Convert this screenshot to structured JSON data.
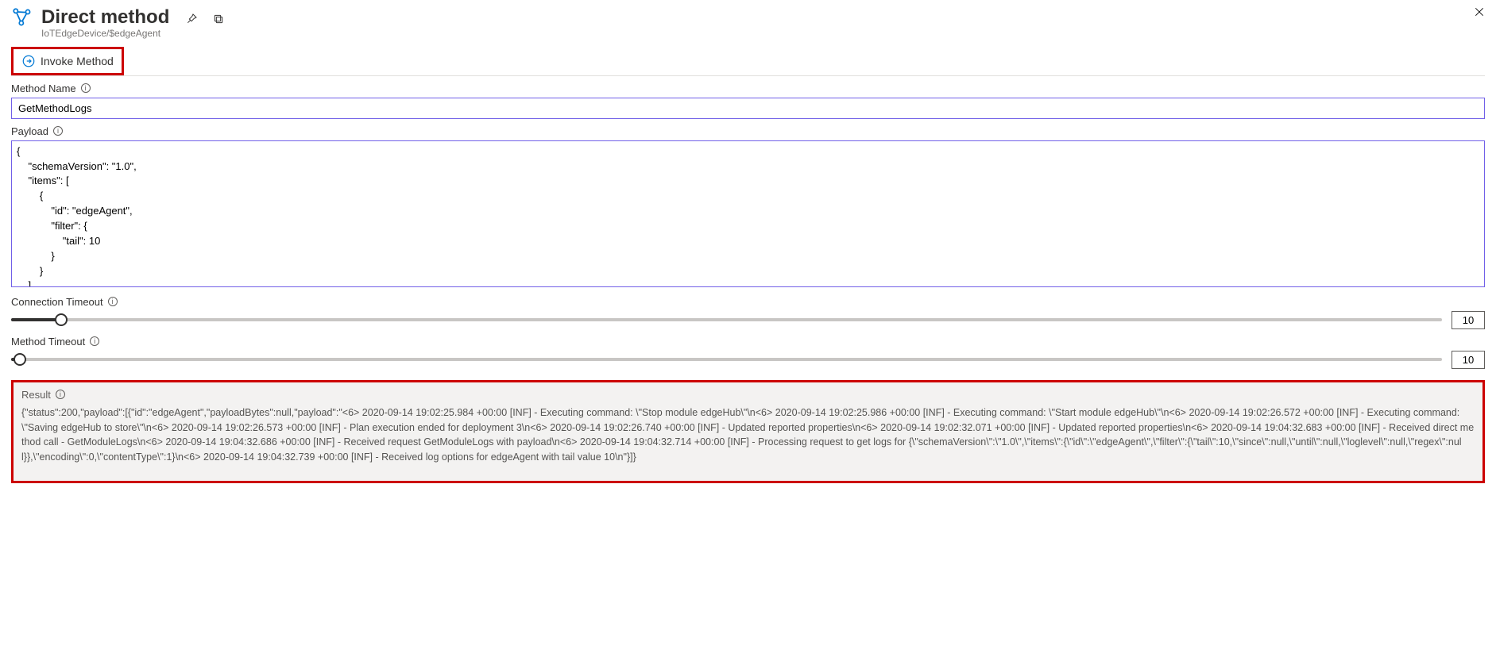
{
  "header": {
    "title": "Direct method",
    "breadcrumb": "IoTEdgeDevice/$edgeAgent"
  },
  "toolbar": {
    "invoke_label": "Invoke Method"
  },
  "method_name": {
    "label": "Method Name",
    "value": "GetMethodLogs"
  },
  "payload": {
    "label": "Payload",
    "value": "{\n    \"schemaVersion\": \"1.0\",\n    \"items\": [\n        {\n            \"id\": \"edgeAgent\",\n            \"filter\": {\n                \"tail\": 10\n            }\n        }\n    ],"
  },
  "connection_timeout": {
    "label": "Connection Timeout",
    "value": "10",
    "fill_pct": 3.5
  },
  "method_timeout": {
    "label": "Method Timeout",
    "value": "10",
    "fill_pct": 0.6
  },
  "result": {
    "label": "Result",
    "text": "{\"status\":200,\"payload\":[{\"id\":\"edgeAgent\",\"payloadBytes\":null,\"payload\":\"<6> 2020-09-14 19:02:25.984 +00:00 [INF] - Executing command: \\\"Stop module edgeHub\\\"\\n<6> 2020-09-14 19:02:25.986 +00:00 [INF] - Executing command: \\\"Start module edgeHub\\\"\\n<6> 2020-09-14 19:02:26.572 +00:00 [INF] - Executing command: \\\"Saving edgeHub to store\\\"\\n<6> 2020-09-14 19:02:26.573 +00:00 [INF] - Plan execution ended for deployment 3\\n<6> 2020-09-14 19:02:26.740 +00:00 [INF] - Updated reported properties\\n<6> 2020-09-14 19:02:32.071 +00:00 [INF] - Updated reported properties\\n<6> 2020-09-14 19:04:32.683 +00:00 [INF] - Received direct method call - GetModuleLogs\\n<6> 2020-09-14 19:04:32.686 +00:00 [INF] - Received request GetModuleLogs with payload\\n<6> 2020-09-14 19:04:32.714 +00:00 [INF] - Processing request to get logs for {\\\"schemaVersion\\\":\\\"1.0\\\",\\\"items\\\":{\\\"id\\\":\\\"edgeAgent\\\",\\\"filter\\\":{\\\"tail\\\":10,\\\"since\\\":null,\\\"until\\\":null,\\\"loglevel\\\":null,\\\"regex\\\":null}},\\\"encoding\\\":0,\\\"contentType\\\":1}\\n<6> 2020-09-14 19:04:32.739 +00:00 [INF] - Received log options for edgeAgent with tail value 10\\n\"}]}"
  }
}
